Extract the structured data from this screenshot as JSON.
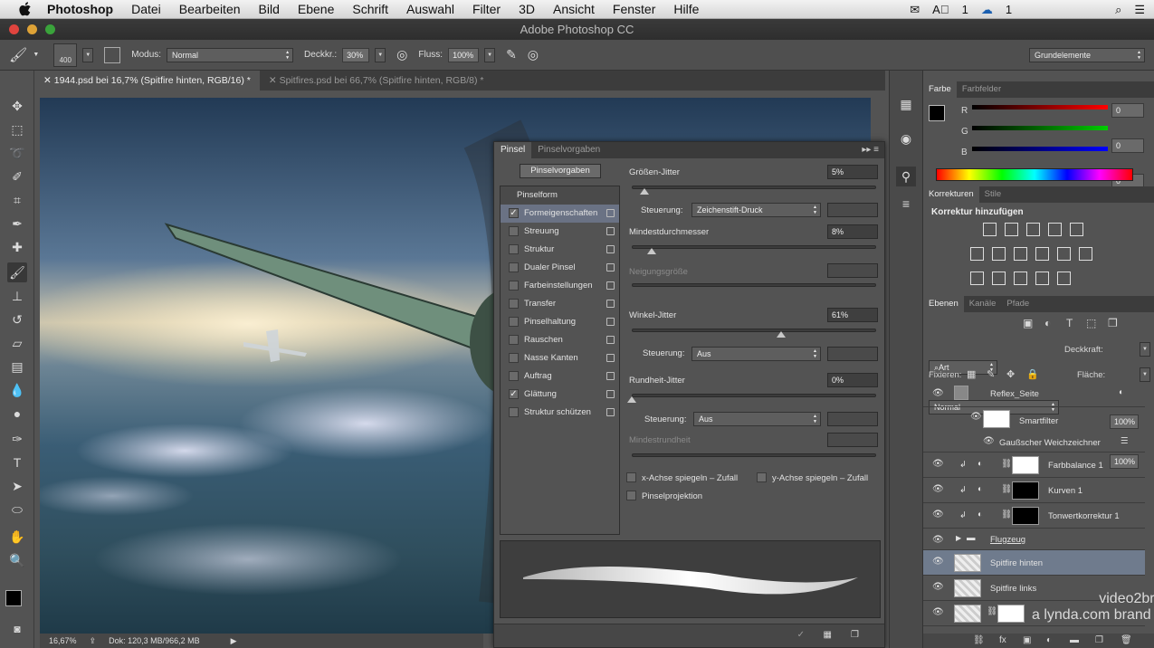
{
  "menubar": {
    "app": "Photoshop",
    "items": [
      "Datei",
      "Bearbeiten",
      "Bild",
      "Ebene",
      "Schrift",
      "Auswahl",
      "Filter",
      "3D",
      "Ansicht",
      "Fenster",
      "Hilfe"
    ],
    "status_a": "1",
    "status_b": "1"
  },
  "window_title": "Adobe Photoshop CC",
  "options": {
    "brush_size": "400",
    "mode_label": "Modus:",
    "mode_value": "Normal",
    "opacity_label": "Deckkr.:",
    "opacity_value": "30%",
    "flow_label": "Fluss:",
    "flow_value": "100%",
    "workspace": "Grundelemente"
  },
  "doc_tabs": [
    {
      "label": "1944.psd bei 16,7% (Spitfire hinten, RGB/16) *",
      "active": true
    },
    {
      "label": "Spitfires.psd bei 66,7% (Spitfire hinten, RGB/8) *",
      "active": false
    }
  ],
  "status": {
    "zoom": "16,67%",
    "doc": "Dok: 120,3 MB/966,2 MB"
  },
  "brush_panel": {
    "tabs": [
      "Pinsel",
      "Pinselvorgaben"
    ],
    "presets_button": "Pinselvorgaben",
    "section": "Pinselform",
    "items": [
      {
        "label": "Formeigenschaften",
        "checked": true,
        "active": true
      },
      {
        "label": "Streuung",
        "checked": false
      },
      {
        "label": "Struktur",
        "checked": false
      },
      {
        "label": "Dualer Pinsel",
        "checked": false
      },
      {
        "label": "Farbeinstellungen",
        "checked": false
      },
      {
        "label": "Transfer",
        "checked": false
      },
      {
        "label": "Pinselhaltung",
        "checked": false
      },
      {
        "label": "Rauschen",
        "checked": false
      },
      {
        "label": "Nasse Kanten",
        "checked": false
      },
      {
        "label": "Auftrag",
        "checked": false
      },
      {
        "label": "Glättung",
        "checked": true
      },
      {
        "label": "Struktur schützen",
        "checked": false
      }
    ],
    "size_jitter_label": "Größen-Jitter",
    "size_jitter_value": "5%",
    "size_jitter_level": 0.05,
    "control_label": "Steuerung:",
    "size_control": "Zeichenstift-Druck",
    "min_diameter_label": "Mindestdurchmesser",
    "min_diameter_value": "8%",
    "min_diameter_level": 0.08,
    "tilt_scale_label": "Neigungsgröße",
    "angle_jitter_label": "Winkel-Jitter",
    "angle_jitter_value": "61%",
    "angle_jitter_level": 0.61,
    "angle_control": "Aus",
    "roundness_jitter_label": "Rundheit-Jitter",
    "roundness_jitter_value": "0%",
    "roundness_jitter_level": 0.0,
    "roundness_control": "Aus",
    "min_roundness_label": "Mindestrundheit",
    "flip_x": "x-Achse spiegeln – Zufall",
    "flip_y": "y-Achse spiegeln – Zufall",
    "projection": "Pinselprojektion"
  },
  "color_panel": {
    "tabs": [
      "Farbe",
      "Farbfelder"
    ],
    "r": "0",
    "g": "0",
    "b": "0",
    "r_label": "R",
    "g_label": "G",
    "b_label": "B"
  },
  "adjustments_panel": {
    "tabs": [
      "Korrekturen",
      "Stile"
    ],
    "heading": "Korrektur hinzufügen"
  },
  "layers_panel": {
    "tabs": [
      "Ebenen",
      "Kanäle",
      "Pfade"
    ],
    "filter": "Art",
    "blend": "Normal",
    "opacity_label": "Deckkraft:",
    "opacity_value": "100%",
    "lock_label": "Fixieren:",
    "fill_label": "Fläche:",
    "fill_value": "100%",
    "layers": [
      {
        "name": "Reflex_Seite"
      },
      {
        "name": "Smartfilter"
      },
      {
        "name": "Gaußscher Weichzeichner"
      },
      {
        "name": "Farbbalance 1"
      },
      {
        "name": "Kurven 1"
      },
      {
        "name": "Tonwertkorrektur 1"
      },
      {
        "name": "Flugzeug"
      },
      {
        "name": "Spitfire hinten"
      },
      {
        "name": "Spitfire links"
      }
    ]
  },
  "watermark": {
    "line1": "video2brain.com",
    "line2": "a lynda.com brand"
  },
  "colors": {
    "accent_select": "#6f7b8d",
    "panel_bg": "#535353",
    "dark_bar": "#3c3c3c"
  }
}
